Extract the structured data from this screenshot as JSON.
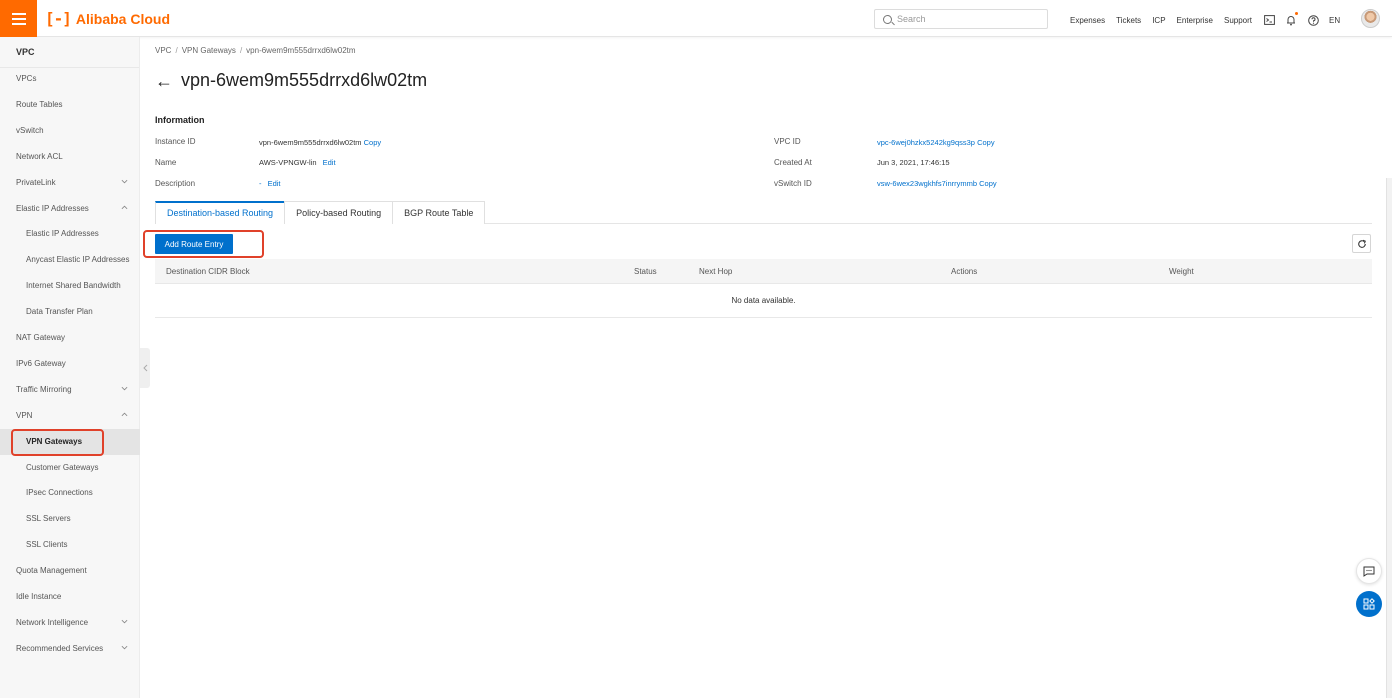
{
  "brand": {
    "logo_text": "Alibaba Cloud",
    "accent": "#ff6a00"
  },
  "topbar": {
    "search_placeholder": "Search",
    "links": [
      "Expenses",
      "Tickets",
      "ICP",
      "Enterprise",
      "Support"
    ],
    "lang": "EN",
    "icons": [
      "terminal-icon",
      "bell-icon",
      "help-icon"
    ]
  },
  "sidebar": {
    "title": "VPC",
    "items": [
      {
        "label": "VPCs"
      },
      {
        "label": "Route Tables"
      },
      {
        "label": "vSwitch"
      },
      {
        "label": "Network ACL"
      },
      {
        "label": "PrivateLink",
        "expandable": true,
        "expanded": false
      },
      {
        "label": "Elastic IP Addresses",
        "expandable": true,
        "expanded": true
      },
      {
        "label": "Elastic IP Addresses",
        "child": true
      },
      {
        "label": "Anycast Elastic IP Addresses",
        "child": true
      },
      {
        "label": "Internet Shared Bandwidth",
        "child": true
      },
      {
        "label": "Data Transfer Plan",
        "child": true
      },
      {
        "label": "NAT Gateway"
      },
      {
        "label": "IPv6 Gateway"
      },
      {
        "label": "Traffic Mirroring",
        "expandable": true,
        "expanded": false
      },
      {
        "label": "VPN",
        "expandable": true,
        "expanded": true
      },
      {
        "label": "VPN Gateways",
        "child": true,
        "active": true
      },
      {
        "label": "Customer Gateways",
        "child": true
      },
      {
        "label": "IPsec Connections",
        "child": true
      },
      {
        "label": "SSL Servers",
        "child": true
      },
      {
        "label": "SSL Clients",
        "child": true
      },
      {
        "label": "Quota Management"
      },
      {
        "label": "Idle Instance"
      },
      {
        "label": "Network Intelligence",
        "expandable": true,
        "expanded": false
      },
      {
        "label": "Recommended Services",
        "expandable": true,
        "expanded": false
      }
    ]
  },
  "breadcrumb": [
    "VPC",
    "VPN Gateways",
    "vpn-6wem9m555drrxd6lw02tm"
  ],
  "page": {
    "title": "vpn-6wem9m555drrxd6lw02tm"
  },
  "info": {
    "section_title": "Information",
    "instance_id": {
      "label": "Instance ID",
      "value": "vpn-6wem9m555drrxd6lw02tm",
      "action": "Copy"
    },
    "name": {
      "label": "Name",
      "value": "AWS-VPNGW-lin",
      "action": "Edit"
    },
    "description": {
      "label": "Description",
      "value": "-",
      "action": "Edit"
    },
    "vpc_id": {
      "label": "VPC ID",
      "value": "vpc-6wej0hzkx5242kg9qss3p",
      "action": "Copy"
    },
    "created_at": {
      "label": "Created At",
      "value": "Jun 3, 2021, 17:46:15"
    },
    "vswitch_id": {
      "label": "vSwitch ID",
      "value": "vsw-6wex23wgkhfs7inrrymmb",
      "action": "Copy"
    }
  },
  "tabs": [
    {
      "label": "Destination-based Routing",
      "active": true
    },
    {
      "label": "Policy-based Routing",
      "active": false
    },
    {
      "label": "BGP Route Table",
      "active": false
    }
  ],
  "actions": {
    "add_route_entry": "Add Route Entry"
  },
  "table": {
    "columns": [
      "Destination CIDR Block",
      "Status",
      "Next Hop",
      "Actions",
      "Weight"
    ],
    "empty_text": "No data available."
  },
  "colors": {
    "link": "#0070cc",
    "primary": "#0070cc",
    "highlight": "#e0412a"
  }
}
